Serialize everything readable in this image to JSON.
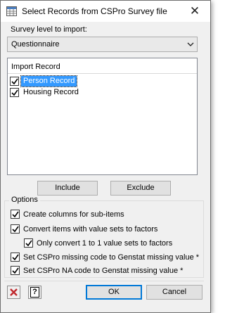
{
  "window": {
    "title": "Select Records from CSPro Survey file",
    "close_glyph": "✕"
  },
  "survey_level": {
    "label": "Survey level to import:",
    "selected": "Questionnaire"
  },
  "import_record": {
    "header": "Import Record",
    "items": [
      {
        "label": "Person Record",
        "checked": true,
        "selected": true
      },
      {
        "label": "Housing Record",
        "checked": true,
        "selected": false
      }
    ]
  },
  "buttons": {
    "include": "Include",
    "exclude": "Exclude",
    "ok": "OK",
    "cancel": "Cancel",
    "help_glyph": "?"
  },
  "options": {
    "title": "Options",
    "items": [
      {
        "label": "Create columns for sub-items",
        "checked": true
      },
      {
        "label": "Convert items with value sets to factors",
        "checked": true
      },
      {
        "label": "Only convert 1 to 1 value sets to factors",
        "checked": true
      },
      {
        "label": "Set CSPro missing code to Genstat missing value *",
        "checked": true
      },
      {
        "label": "Set CSPro NA code to Genstat missing value *",
        "checked": true
      }
    ]
  },
  "icons": {
    "app": "grid-icon",
    "reset": "red-x-icon",
    "help": "help-icon",
    "dropdown": "chevron-down-icon"
  },
  "colors": {
    "selection": "#3399ff",
    "default_button_border": "#0078d7",
    "reset_red": "#c0282d"
  }
}
